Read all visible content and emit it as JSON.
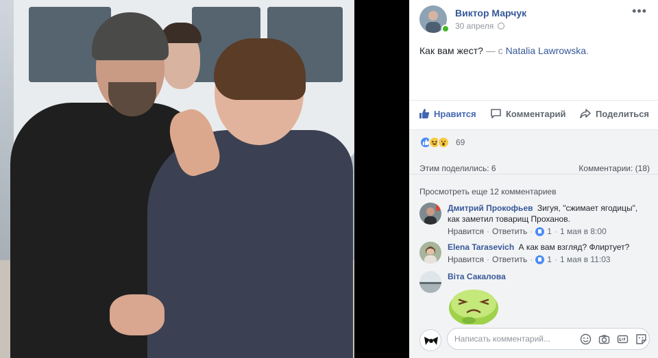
{
  "post": {
    "author": "Виктор Марчук",
    "date": "30 апреля",
    "text": "Как вам жест?",
    "with_text": " — с ",
    "tagged": "Natalia Lawrowska",
    "tag_suffix": "."
  },
  "actions": {
    "like": "Нравится",
    "comment": "Комментарий",
    "share": "Поделиться"
  },
  "reactions": {
    "count": "69",
    "types": [
      "like-icon",
      "haha-icon",
      "wow-icon"
    ]
  },
  "stats": {
    "shares": "Этим поделились: 6",
    "comments": "Комментарии: (18)"
  },
  "see_more": "Просмотреть еще 12 комментариев",
  "comments": [
    {
      "name": "Дмитрий Прокофьев",
      "text": "Зигуя, \"сжимает ягодицы\", как заметил товарищ Проханов.",
      "like": "Нравится",
      "reply": "Ответить",
      "likes": "1",
      "time": "1 мая в 8:00"
    },
    {
      "name": "Elena Tarasevich",
      "text": "А как вам взгляд? Флиртует?",
      "like": "Нравится",
      "reply": "Ответить",
      "likes": "1",
      "time": "1 мая в 11:03"
    },
    {
      "name": "Віта Сакалова",
      "text": "",
      "sticker": "sick-sticker"
    }
  ],
  "composer": {
    "placeholder": "Написать комментарий..."
  },
  "colors": {
    "link": "#365899",
    "like_blue": "#4267b2",
    "panel_bg": "#f2f3f5"
  }
}
